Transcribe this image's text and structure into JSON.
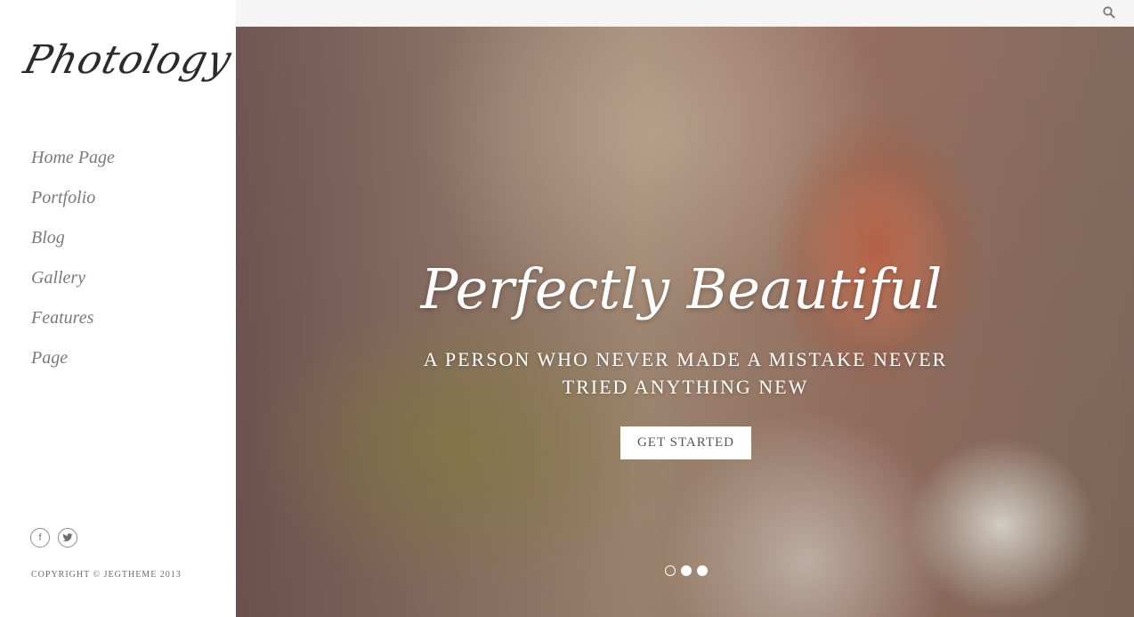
{
  "logo": {
    "text": "Photology"
  },
  "nav": {
    "items": [
      {
        "label": "Home Page"
      },
      {
        "label": "Portfolio"
      },
      {
        "label": "Blog"
      },
      {
        "label": "Gallery"
      },
      {
        "label": "Features"
      },
      {
        "label": "Page"
      }
    ]
  },
  "social": {
    "facebook_icon": "f",
    "twitter_icon": "t"
  },
  "copyright": "COPYRIGHT © JEGTHEME 2013",
  "topbar": {
    "search_icon": "search-icon"
  },
  "hero": {
    "title": "Perfectly Beautiful",
    "subtitle": "A PERSON WHO NEVER MADE A MISTAKE NEVER TRIED ANYTHING NEW",
    "cta_label": "GET STARTED",
    "slides_total": 3,
    "active_slide": 1
  },
  "colors": {
    "sidebar_bg": "#ffffff",
    "nav_text": "#7a7a7a",
    "topbar_bg": "#f5f5f5",
    "hero_text": "#ffffff"
  }
}
